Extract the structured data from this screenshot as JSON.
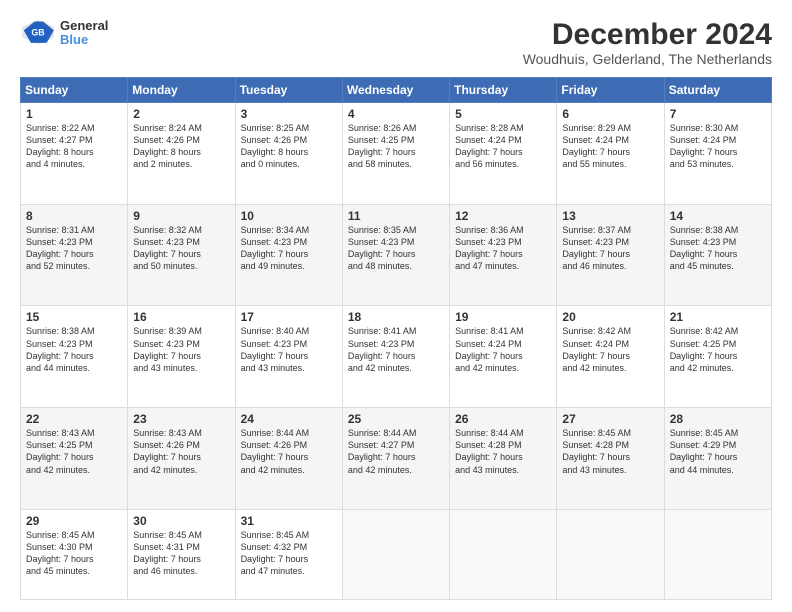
{
  "header": {
    "logo_line1": "General",
    "logo_line2": "Blue",
    "title": "December 2024",
    "subtitle": "Woudhuis, Gelderland, The Netherlands"
  },
  "days_of_week": [
    "Sunday",
    "Monday",
    "Tuesday",
    "Wednesday",
    "Thursday",
    "Friday",
    "Saturday"
  ],
  "weeks": [
    [
      {
        "day": "1",
        "info": "Sunrise: 8:22 AM\nSunset: 4:27 PM\nDaylight: 8 hours\nand 4 minutes."
      },
      {
        "day": "2",
        "info": "Sunrise: 8:24 AM\nSunset: 4:26 PM\nDaylight: 8 hours\nand 2 minutes."
      },
      {
        "day": "3",
        "info": "Sunrise: 8:25 AM\nSunset: 4:26 PM\nDaylight: 8 hours\nand 0 minutes."
      },
      {
        "day": "4",
        "info": "Sunrise: 8:26 AM\nSunset: 4:25 PM\nDaylight: 7 hours\nand 58 minutes."
      },
      {
        "day": "5",
        "info": "Sunrise: 8:28 AM\nSunset: 4:24 PM\nDaylight: 7 hours\nand 56 minutes."
      },
      {
        "day": "6",
        "info": "Sunrise: 8:29 AM\nSunset: 4:24 PM\nDaylight: 7 hours\nand 55 minutes."
      },
      {
        "day": "7",
        "info": "Sunrise: 8:30 AM\nSunset: 4:24 PM\nDaylight: 7 hours\nand 53 minutes."
      }
    ],
    [
      {
        "day": "8",
        "info": "Sunrise: 8:31 AM\nSunset: 4:23 PM\nDaylight: 7 hours\nand 52 minutes."
      },
      {
        "day": "9",
        "info": "Sunrise: 8:32 AM\nSunset: 4:23 PM\nDaylight: 7 hours\nand 50 minutes."
      },
      {
        "day": "10",
        "info": "Sunrise: 8:34 AM\nSunset: 4:23 PM\nDaylight: 7 hours\nand 49 minutes."
      },
      {
        "day": "11",
        "info": "Sunrise: 8:35 AM\nSunset: 4:23 PM\nDaylight: 7 hours\nand 48 minutes."
      },
      {
        "day": "12",
        "info": "Sunrise: 8:36 AM\nSunset: 4:23 PM\nDaylight: 7 hours\nand 47 minutes."
      },
      {
        "day": "13",
        "info": "Sunrise: 8:37 AM\nSunset: 4:23 PM\nDaylight: 7 hours\nand 46 minutes."
      },
      {
        "day": "14",
        "info": "Sunrise: 8:38 AM\nSunset: 4:23 PM\nDaylight: 7 hours\nand 45 minutes."
      }
    ],
    [
      {
        "day": "15",
        "info": "Sunrise: 8:38 AM\nSunset: 4:23 PM\nDaylight: 7 hours\nand 44 minutes."
      },
      {
        "day": "16",
        "info": "Sunrise: 8:39 AM\nSunset: 4:23 PM\nDaylight: 7 hours\nand 43 minutes."
      },
      {
        "day": "17",
        "info": "Sunrise: 8:40 AM\nSunset: 4:23 PM\nDaylight: 7 hours\nand 43 minutes."
      },
      {
        "day": "18",
        "info": "Sunrise: 8:41 AM\nSunset: 4:23 PM\nDaylight: 7 hours\nand 42 minutes."
      },
      {
        "day": "19",
        "info": "Sunrise: 8:41 AM\nSunset: 4:24 PM\nDaylight: 7 hours\nand 42 minutes."
      },
      {
        "day": "20",
        "info": "Sunrise: 8:42 AM\nSunset: 4:24 PM\nDaylight: 7 hours\nand 42 minutes."
      },
      {
        "day": "21",
        "info": "Sunrise: 8:42 AM\nSunset: 4:25 PM\nDaylight: 7 hours\nand 42 minutes."
      }
    ],
    [
      {
        "day": "22",
        "info": "Sunrise: 8:43 AM\nSunset: 4:25 PM\nDaylight: 7 hours\nand 42 minutes."
      },
      {
        "day": "23",
        "info": "Sunrise: 8:43 AM\nSunset: 4:26 PM\nDaylight: 7 hours\nand 42 minutes."
      },
      {
        "day": "24",
        "info": "Sunrise: 8:44 AM\nSunset: 4:26 PM\nDaylight: 7 hours\nand 42 minutes."
      },
      {
        "day": "25",
        "info": "Sunrise: 8:44 AM\nSunset: 4:27 PM\nDaylight: 7 hours\nand 42 minutes."
      },
      {
        "day": "26",
        "info": "Sunrise: 8:44 AM\nSunset: 4:28 PM\nDaylight: 7 hours\nand 43 minutes."
      },
      {
        "day": "27",
        "info": "Sunrise: 8:45 AM\nSunset: 4:28 PM\nDaylight: 7 hours\nand 43 minutes."
      },
      {
        "day": "28",
        "info": "Sunrise: 8:45 AM\nSunset: 4:29 PM\nDaylight: 7 hours\nand 44 minutes."
      }
    ],
    [
      {
        "day": "29",
        "info": "Sunrise: 8:45 AM\nSunset: 4:30 PM\nDaylight: 7 hours\nand 45 minutes."
      },
      {
        "day": "30",
        "info": "Sunrise: 8:45 AM\nSunset: 4:31 PM\nDaylight: 7 hours\nand 46 minutes."
      },
      {
        "day": "31",
        "info": "Sunrise: 8:45 AM\nSunset: 4:32 PM\nDaylight: 7 hours\nand 47 minutes."
      },
      {
        "day": "",
        "info": ""
      },
      {
        "day": "",
        "info": ""
      },
      {
        "day": "",
        "info": ""
      },
      {
        "day": "",
        "info": ""
      }
    ]
  ]
}
